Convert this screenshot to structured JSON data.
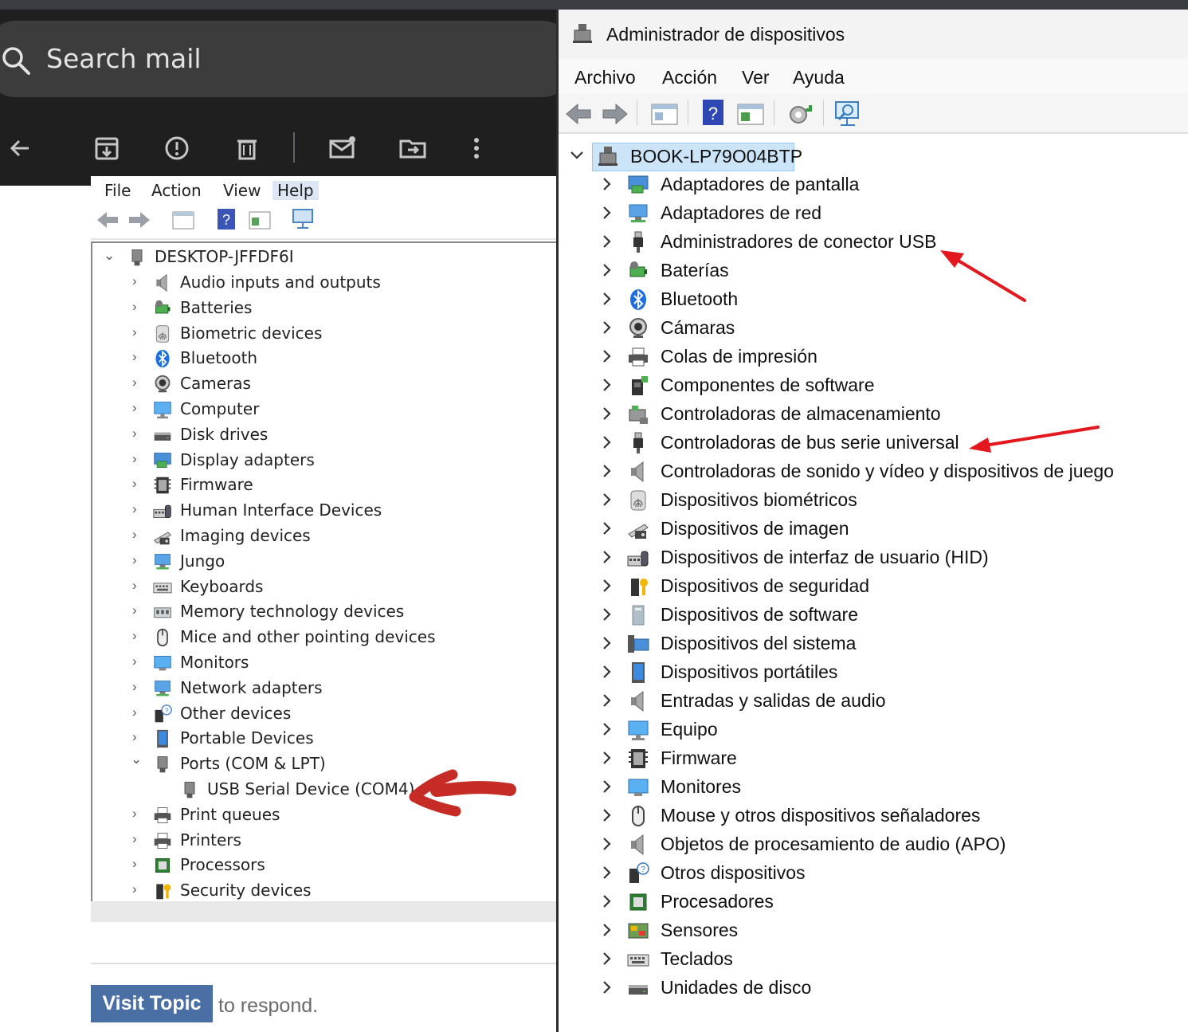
{
  "mail": {
    "search_placeholder": "Search mail"
  },
  "old_screenshot": {
    "menu": [
      "File",
      "Action",
      "View",
      "Help"
    ],
    "root": "DESKTOP-JFFDF6I",
    "items": [
      {
        "label": "Audio inputs and outputs",
        "icon": "speaker-icon"
      },
      {
        "label": "Batteries",
        "icon": "battery-icon"
      },
      {
        "label": "Biometric devices",
        "icon": "fingerprint-icon"
      },
      {
        "label": "Bluetooth",
        "icon": "bluetooth-icon"
      },
      {
        "label": "Cameras",
        "icon": "camera-icon"
      },
      {
        "label": "Computer",
        "icon": "computer-icon"
      },
      {
        "label": "Disk drives",
        "icon": "disk-drive-icon"
      },
      {
        "label": "Display adapters",
        "icon": "display-adapter-icon"
      },
      {
        "label": "Firmware",
        "icon": "firmware-icon"
      },
      {
        "label": "Human Interface Devices",
        "icon": "hid-icon"
      },
      {
        "label": "Imaging devices",
        "icon": "scanner-icon"
      },
      {
        "label": "Jungo",
        "icon": "monitor-network-icon"
      },
      {
        "label": "Keyboards",
        "icon": "keyboard-icon"
      },
      {
        "label": "Memory technology devices",
        "icon": "memory-icon"
      },
      {
        "label": "Mice and other pointing devices",
        "icon": "mouse-icon"
      },
      {
        "label": "Monitors",
        "icon": "monitor-icon"
      },
      {
        "label": "Network adapters",
        "icon": "network-icon"
      },
      {
        "label": "Other devices",
        "icon": "unknown-device-icon"
      },
      {
        "label": "Portable Devices",
        "icon": "portable-device-icon"
      },
      {
        "label": "Ports (COM & LPT)",
        "icon": "port-icon",
        "expanded": true
      },
      {
        "label": "USB Serial Device (COM4)",
        "icon": "port-icon",
        "child": true
      },
      {
        "label": "Print queues",
        "icon": "printer-icon"
      },
      {
        "label": "Printers",
        "icon": "printer-icon"
      },
      {
        "label": "Processors",
        "icon": "processor-icon"
      },
      {
        "label": "Security devices",
        "icon": "security-icon"
      }
    ]
  },
  "forum": {
    "visit_button": "Visit Topic",
    "respond_text": "to respond."
  },
  "device_manager": {
    "title": "Administrador de dispositivos",
    "menu": [
      "Archivo",
      "Acción",
      "Ver",
      "Ayuda"
    ],
    "root": "BOOK-LP79O04BTP",
    "items": [
      {
        "label": "Adaptadores de pantalla",
        "icon": "display-adapter-icon"
      },
      {
        "label": "Adaptadores de red",
        "icon": "network-icon"
      },
      {
        "label": "Administradores de conector USB",
        "icon": "usb-icon"
      },
      {
        "label": "Baterías",
        "icon": "battery-icon"
      },
      {
        "label": "Bluetooth",
        "icon": "bluetooth-icon"
      },
      {
        "label": "Cámaras",
        "icon": "camera-icon"
      },
      {
        "label": "Colas de impresión",
        "icon": "printer-icon"
      },
      {
        "label": "Componentes de software",
        "icon": "software-component-icon"
      },
      {
        "label": "Controladoras de almacenamiento",
        "icon": "storage-controller-icon"
      },
      {
        "label": "Controladoras de bus serie universal",
        "icon": "usb-icon"
      },
      {
        "label": "Controladoras de sonido y vídeo y dispositivos de juego",
        "icon": "speaker-icon"
      },
      {
        "label": "Dispositivos biométricos",
        "icon": "fingerprint-icon"
      },
      {
        "label": "Dispositivos de imagen",
        "icon": "scanner-icon"
      },
      {
        "label": "Dispositivos de interfaz de usuario (HID)",
        "icon": "hid-icon"
      },
      {
        "label": "Dispositivos de seguridad",
        "icon": "security-icon"
      },
      {
        "label": "Dispositivos de software",
        "icon": "software-device-icon"
      },
      {
        "label": "Dispositivos del sistema",
        "icon": "system-device-icon"
      },
      {
        "label": "Dispositivos portátiles",
        "icon": "portable-device-icon"
      },
      {
        "label": "Entradas y salidas de audio",
        "icon": "speaker-icon"
      },
      {
        "label": "Equipo",
        "icon": "computer-icon"
      },
      {
        "label": "Firmware",
        "icon": "firmware-icon"
      },
      {
        "label": "Monitores",
        "icon": "monitor-icon"
      },
      {
        "label": "Mouse y otros dispositivos señaladores",
        "icon": "mouse-icon"
      },
      {
        "label": "Objetos de procesamiento de audio (APO)",
        "icon": "speaker-icon"
      },
      {
        "label": "Otros dispositivos",
        "icon": "unknown-device-icon"
      },
      {
        "label": "Procesadores",
        "icon": "processor-icon"
      },
      {
        "label": "Sensores",
        "icon": "sensor-icon"
      },
      {
        "label": "Teclados",
        "icon": "keyboard-icon"
      },
      {
        "label": "Unidades de disco",
        "icon": "disk-drive-icon"
      }
    ]
  },
  "colors": {
    "mail_header": "#1f1f1f",
    "selection": "#cce4f7",
    "annotation_red": "#e3171e",
    "visit_button": "#4a6fa5"
  }
}
